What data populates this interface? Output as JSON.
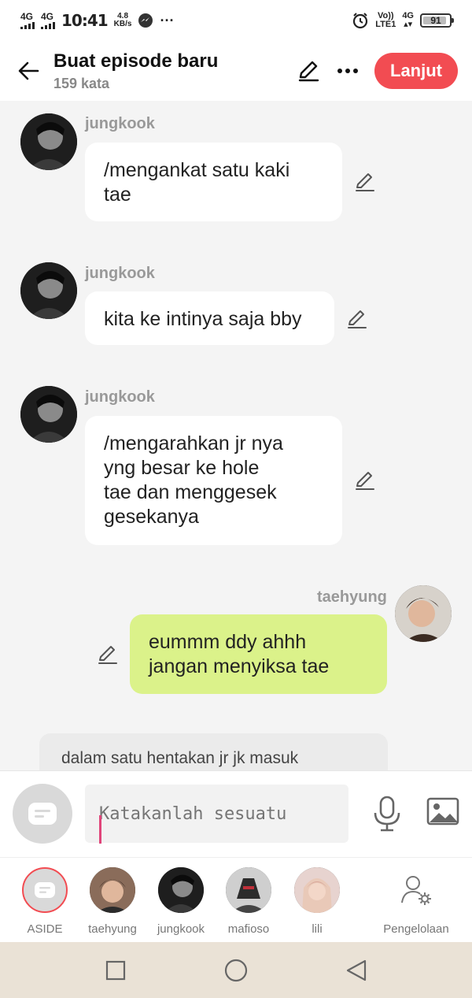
{
  "status": {
    "sim1": "4G",
    "sim2": "4G",
    "time": "10:41",
    "speed_value": "4.8",
    "speed_unit": "KB/s",
    "dots": "···",
    "volte": "Vo))",
    "lte": "LTE1",
    "net": "4G",
    "battery": "91",
    "battery_level": 0.91
  },
  "header": {
    "title": "Buat episode baru",
    "subtitle": "159 kata",
    "next_label": "Lanjut"
  },
  "messages": [
    {
      "sender": "jungkook",
      "lines": [
        "/mengankat satu kaki",
        "tae"
      ]
    },
    {
      "sender": "jungkook",
      "lines": [
        "kita ke intinya saja bby"
      ]
    },
    {
      "sender": "jungkook",
      "lines": [
        "/mengarahkan jr nya",
        "yng besar ke hole",
        "tae dan menggesek",
        "gesekanya"
      ]
    },
    {
      "sender": "taehyung",
      "lines": [
        "eummm ddy ahhh",
        "jangan menyiksa tae"
      ]
    }
  ],
  "narration": "dalam satu hentakan jr jk masuk",
  "input": {
    "placeholder": "Katakanlah sesuatu"
  },
  "characters": [
    {
      "label": "ASIDE"
    },
    {
      "label": "taehyung"
    },
    {
      "label": "jungkook"
    },
    {
      "label": "mafioso"
    },
    {
      "label": "lili"
    },
    {
      "label": "Pengelolaan"
    }
  ],
  "colors": {
    "accent": "#f24c52",
    "my_bubble": "#dbf28a",
    "bubble": "#ffffff",
    "nav_bg": "#eae2d6"
  }
}
